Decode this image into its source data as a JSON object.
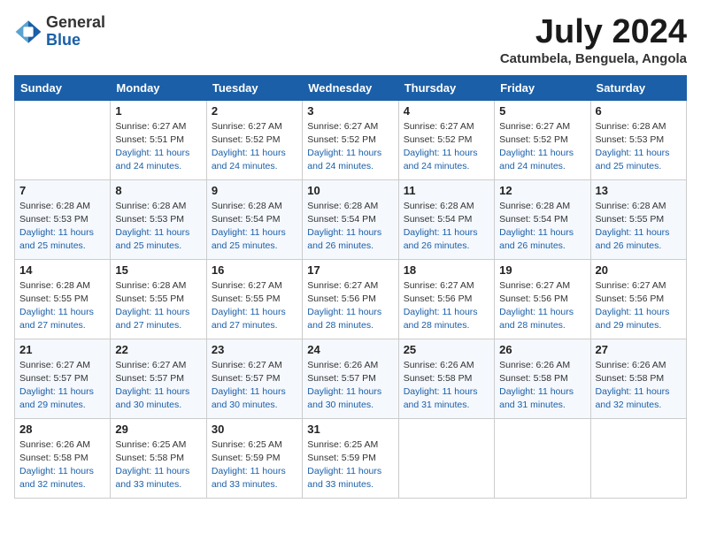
{
  "header": {
    "logo": {
      "general": "General",
      "blue": "Blue"
    },
    "title": "July 2024",
    "location": "Catumbela, Benguela, Angola"
  },
  "days_of_week": [
    "Sunday",
    "Monday",
    "Tuesday",
    "Wednesday",
    "Thursday",
    "Friday",
    "Saturday"
  ],
  "weeks": [
    [
      {
        "day": "",
        "sunrise": "",
        "sunset": "",
        "daylight": ""
      },
      {
        "day": "1",
        "sunrise": "Sunrise: 6:27 AM",
        "sunset": "Sunset: 5:51 PM",
        "daylight": "Daylight: 11 hours and 24 minutes."
      },
      {
        "day": "2",
        "sunrise": "Sunrise: 6:27 AM",
        "sunset": "Sunset: 5:52 PM",
        "daylight": "Daylight: 11 hours and 24 minutes."
      },
      {
        "day": "3",
        "sunrise": "Sunrise: 6:27 AM",
        "sunset": "Sunset: 5:52 PM",
        "daylight": "Daylight: 11 hours and 24 minutes."
      },
      {
        "day": "4",
        "sunrise": "Sunrise: 6:27 AM",
        "sunset": "Sunset: 5:52 PM",
        "daylight": "Daylight: 11 hours and 24 minutes."
      },
      {
        "day": "5",
        "sunrise": "Sunrise: 6:27 AM",
        "sunset": "Sunset: 5:52 PM",
        "daylight": "Daylight: 11 hours and 24 minutes."
      },
      {
        "day": "6",
        "sunrise": "Sunrise: 6:28 AM",
        "sunset": "Sunset: 5:53 PM",
        "daylight": "Daylight: 11 hours and 25 minutes."
      }
    ],
    [
      {
        "day": "7",
        "sunrise": "Sunrise: 6:28 AM",
        "sunset": "Sunset: 5:53 PM",
        "daylight": "Daylight: 11 hours and 25 minutes."
      },
      {
        "day": "8",
        "sunrise": "Sunrise: 6:28 AM",
        "sunset": "Sunset: 5:53 PM",
        "daylight": "Daylight: 11 hours and 25 minutes."
      },
      {
        "day": "9",
        "sunrise": "Sunrise: 6:28 AM",
        "sunset": "Sunset: 5:54 PM",
        "daylight": "Daylight: 11 hours and 25 minutes."
      },
      {
        "day": "10",
        "sunrise": "Sunrise: 6:28 AM",
        "sunset": "Sunset: 5:54 PM",
        "daylight": "Daylight: 11 hours and 26 minutes."
      },
      {
        "day": "11",
        "sunrise": "Sunrise: 6:28 AM",
        "sunset": "Sunset: 5:54 PM",
        "daylight": "Daylight: 11 hours and 26 minutes."
      },
      {
        "day": "12",
        "sunrise": "Sunrise: 6:28 AM",
        "sunset": "Sunset: 5:54 PM",
        "daylight": "Daylight: 11 hours and 26 minutes."
      },
      {
        "day": "13",
        "sunrise": "Sunrise: 6:28 AM",
        "sunset": "Sunset: 5:55 PM",
        "daylight": "Daylight: 11 hours and 26 minutes."
      }
    ],
    [
      {
        "day": "14",
        "sunrise": "Sunrise: 6:28 AM",
        "sunset": "Sunset: 5:55 PM",
        "daylight": "Daylight: 11 hours and 27 minutes."
      },
      {
        "day": "15",
        "sunrise": "Sunrise: 6:28 AM",
        "sunset": "Sunset: 5:55 PM",
        "daylight": "Daylight: 11 hours and 27 minutes."
      },
      {
        "day": "16",
        "sunrise": "Sunrise: 6:27 AM",
        "sunset": "Sunset: 5:55 PM",
        "daylight": "Daylight: 11 hours and 27 minutes."
      },
      {
        "day": "17",
        "sunrise": "Sunrise: 6:27 AM",
        "sunset": "Sunset: 5:56 PM",
        "daylight": "Daylight: 11 hours and 28 minutes."
      },
      {
        "day": "18",
        "sunrise": "Sunrise: 6:27 AM",
        "sunset": "Sunset: 5:56 PM",
        "daylight": "Daylight: 11 hours and 28 minutes."
      },
      {
        "day": "19",
        "sunrise": "Sunrise: 6:27 AM",
        "sunset": "Sunset: 5:56 PM",
        "daylight": "Daylight: 11 hours and 28 minutes."
      },
      {
        "day": "20",
        "sunrise": "Sunrise: 6:27 AM",
        "sunset": "Sunset: 5:56 PM",
        "daylight": "Daylight: 11 hours and 29 minutes."
      }
    ],
    [
      {
        "day": "21",
        "sunrise": "Sunrise: 6:27 AM",
        "sunset": "Sunset: 5:57 PM",
        "daylight": "Daylight: 11 hours and 29 minutes."
      },
      {
        "day": "22",
        "sunrise": "Sunrise: 6:27 AM",
        "sunset": "Sunset: 5:57 PM",
        "daylight": "Daylight: 11 hours and 30 minutes."
      },
      {
        "day": "23",
        "sunrise": "Sunrise: 6:27 AM",
        "sunset": "Sunset: 5:57 PM",
        "daylight": "Daylight: 11 hours and 30 minutes."
      },
      {
        "day": "24",
        "sunrise": "Sunrise: 6:26 AM",
        "sunset": "Sunset: 5:57 PM",
        "daylight": "Daylight: 11 hours and 30 minutes."
      },
      {
        "day": "25",
        "sunrise": "Sunrise: 6:26 AM",
        "sunset": "Sunset: 5:58 PM",
        "daylight": "Daylight: 11 hours and 31 minutes."
      },
      {
        "day": "26",
        "sunrise": "Sunrise: 6:26 AM",
        "sunset": "Sunset: 5:58 PM",
        "daylight": "Daylight: 11 hours and 31 minutes."
      },
      {
        "day": "27",
        "sunrise": "Sunrise: 6:26 AM",
        "sunset": "Sunset: 5:58 PM",
        "daylight": "Daylight: 11 hours and 32 minutes."
      }
    ],
    [
      {
        "day": "28",
        "sunrise": "Sunrise: 6:26 AM",
        "sunset": "Sunset: 5:58 PM",
        "daylight": "Daylight: 11 hours and 32 minutes."
      },
      {
        "day": "29",
        "sunrise": "Sunrise: 6:25 AM",
        "sunset": "Sunset: 5:58 PM",
        "daylight": "Daylight: 11 hours and 33 minutes."
      },
      {
        "day": "30",
        "sunrise": "Sunrise: 6:25 AM",
        "sunset": "Sunset: 5:59 PM",
        "daylight": "Daylight: 11 hours and 33 minutes."
      },
      {
        "day": "31",
        "sunrise": "Sunrise: 6:25 AM",
        "sunset": "Sunset: 5:59 PM",
        "daylight": "Daylight: 11 hours and 33 minutes."
      },
      {
        "day": "",
        "sunrise": "",
        "sunset": "",
        "daylight": ""
      },
      {
        "day": "",
        "sunrise": "",
        "sunset": "",
        "daylight": ""
      },
      {
        "day": "",
        "sunrise": "",
        "sunset": "",
        "daylight": ""
      }
    ]
  ]
}
